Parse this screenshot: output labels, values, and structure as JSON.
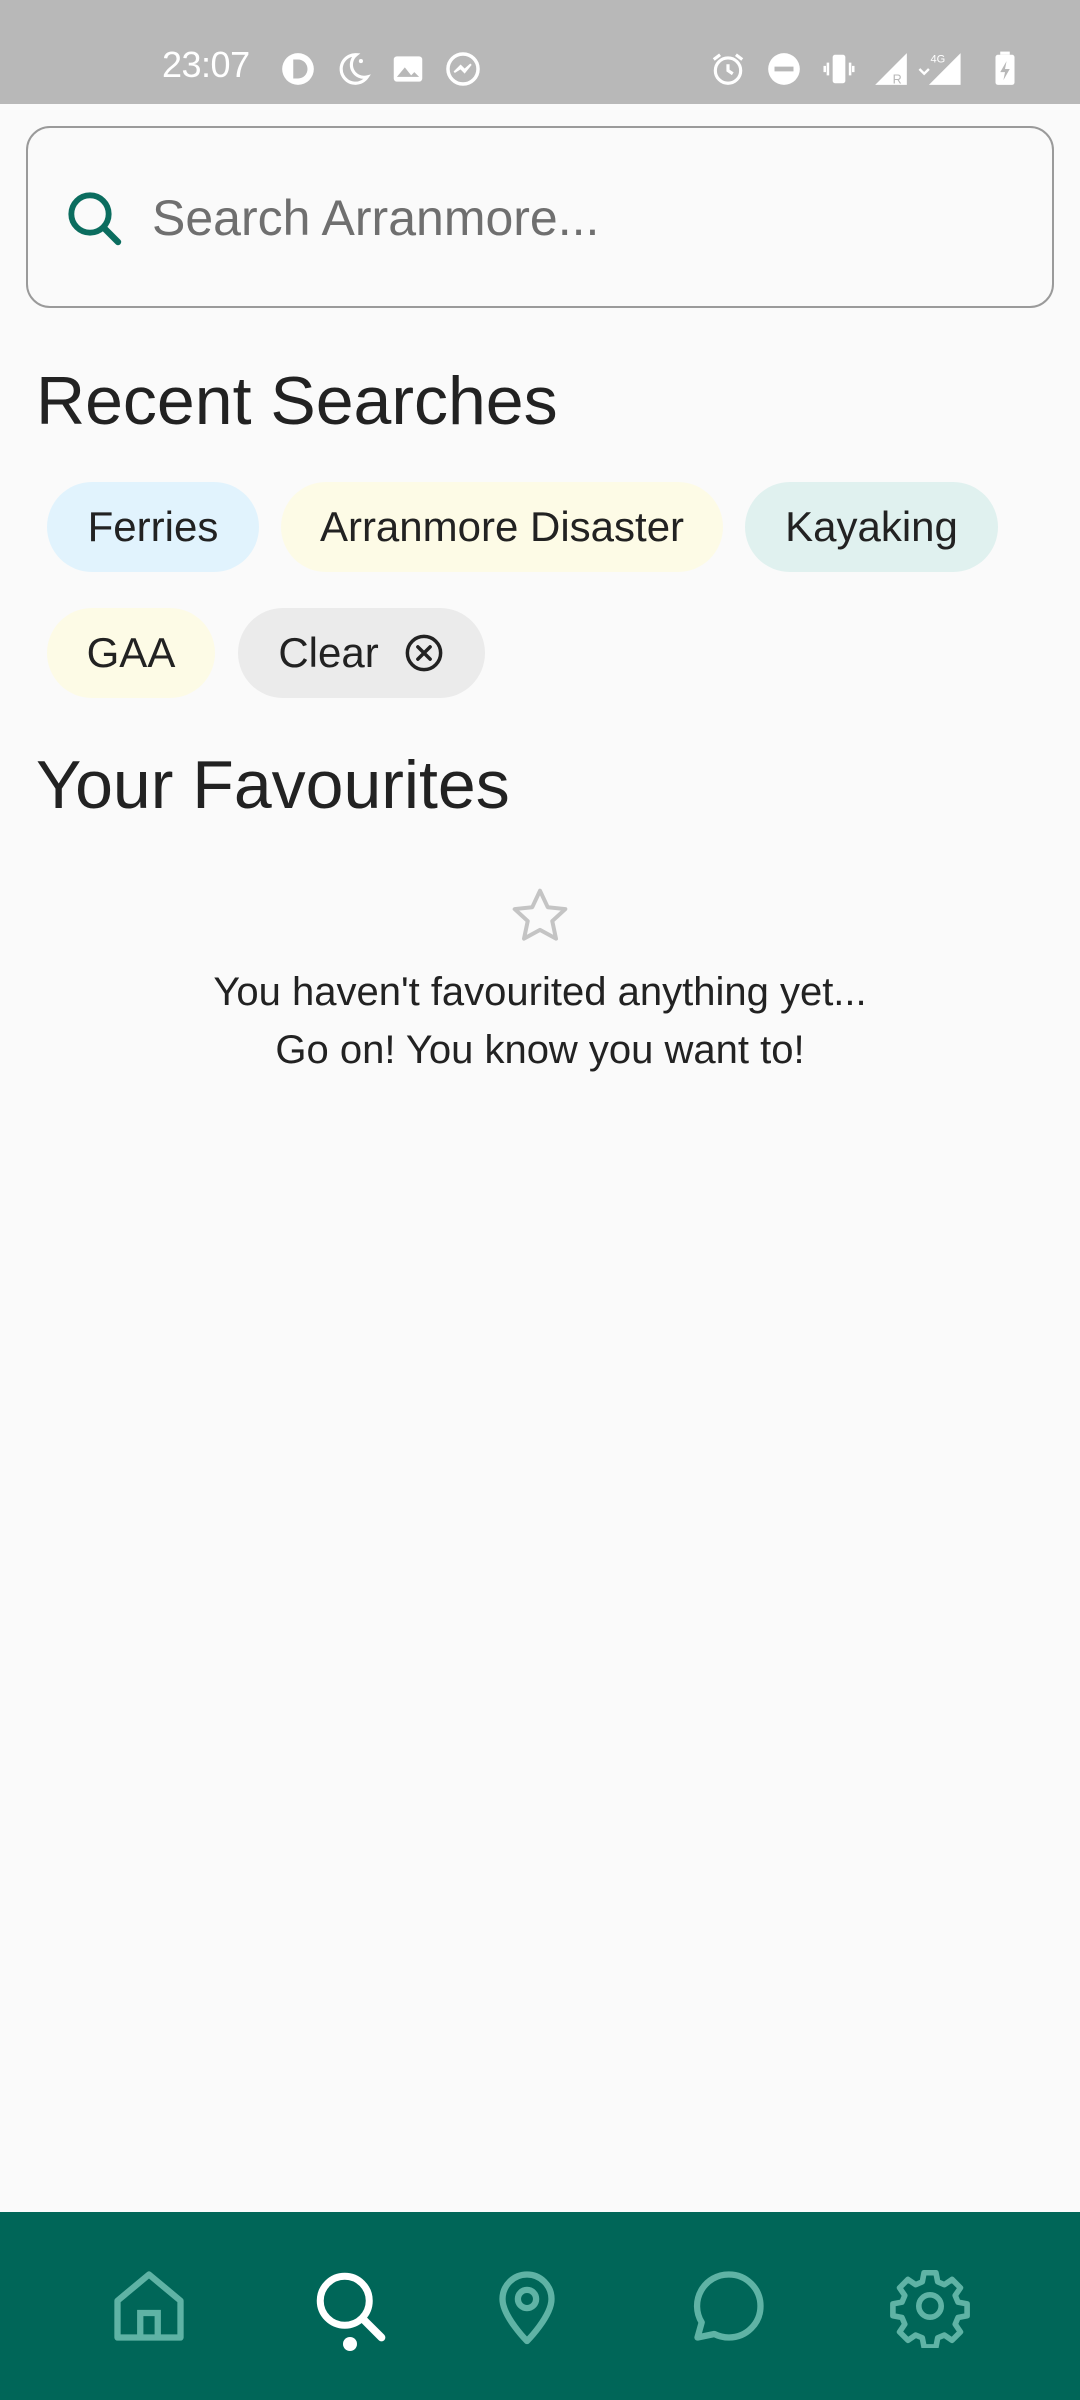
{
  "status_bar": {
    "time": "23:07",
    "left_icons": [
      "app-notification-icon",
      "moon-icon",
      "image-icon",
      "messenger-icon"
    ],
    "right_icons": [
      "alarm-icon",
      "do-not-disturb-icon",
      "vibrate-icon",
      "signal-roaming-icon",
      "signal-4g-icon",
      "battery-charging-icon"
    ],
    "network_label": "4G"
  },
  "search": {
    "placeholder": "Search Arranmore...",
    "value": ""
  },
  "recent_searches": {
    "title": "Recent Searches",
    "chips": [
      {
        "label": "Ferries",
        "color": "#e1f3fd"
      },
      {
        "label": "Arranmore Disaster",
        "color": "#fdfbe6"
      },
      {
        "label": "Kayaking",
        "color": "#e0f1ef"
      },
      {
        "label": "GAA",
        "color": "#fdfbe6"
      }
    ],
    "clear_label": "Clear",
    "clear_color": "#ebebeb"
  },
  "favourites": {
    "title": "Your Favourites",
    "empty_line1": "You haven't favourited anything yet...",
    "empty_line2": "Go on! You know you want to!"
  },
  "bottom_nav": {
    "background": "#006658",
    "items": [
      "home-icon",
      "search-icon",
      "map-pin-icon",
      "chat-icon",
      "settings-icon"
    ],
    "active": "search-icon"
  }
}
